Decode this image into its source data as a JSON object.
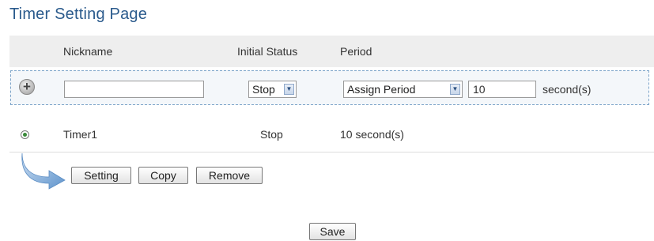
{
  "page": {
    "title": "Timer Setting Page"
  },
  "table": {
    "headers": {
      "nickname": "Nickname",
      "initial_status": "Initial Status",
      "period": "Period"
    }
  },
  "add_row": {
    "nickname_value": "",
    "status_selected": "Stop",
    "period_selected": "Assign Period",
    "period_value": "10",
    "unit_label": "second(s)"
  },
  "timers": [
    {
      "nickname": "Timer1",
      "initial_status": "Stop",
      "period": "10 second(s)"
    }
  ],
  "actions": {
    "setting": "Setting",
    "copy": "Copy",
    "remove": "Remove"
  },
  "save_label": "Save"
}
